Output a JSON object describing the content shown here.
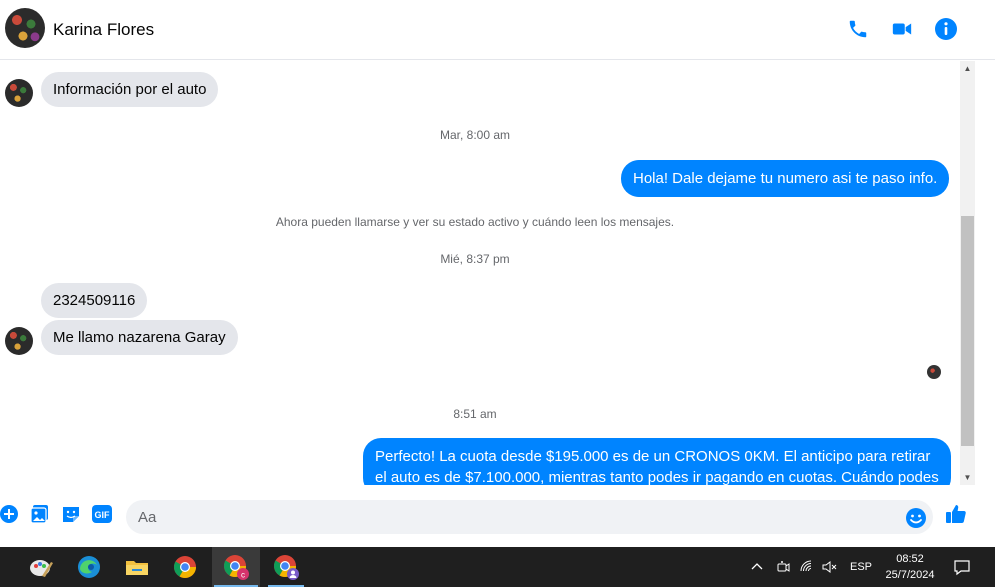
{
  "header": {
    "contact_name": "Karina Flores",
    "icons": [
      "phone-icon",
      "video-camera-icon",
      "info-icon"
    ]
  },
  "messages": {
    "incoming_1": "Información por el auto",
    "timestamp_1": "Mar, 8:00 am",
    "outgoing_1": "Hola! Dale dejame tu numero  asi te paso info.",
    "system_notice": "Ahora pueden llamarse y ver su estado activo y cuándo leen los mensajes.",
    "timestamp_2": "Mié, 8:37 pm",
    "incoming_2": "2324509116",
    "incoming_3": "Me llamo nazarena Garay",
    "timestamp_3": "8:51 am",
    "outgoing_2": "Perfecto! La cuota desde $195.000 es de un CRONOS 0KM. El anticipo para retirar el auto es de $7.100.000, mientras tanto podes ir pagando en cuotas. Cuándo podes"
  },
  "composer": {
    "placeholder": "Aa",
    "gif_label": "GIF"
  },
  "taskbar": {
    "language": "ESP",
    "time": "08:52",
    "date": "25/7/2024"
  },
  "colors": {
    "accent": "#0084ff",
    "incoming_bubble": "#e4e6eb",
    "taskbar": "#1f1f1f"
  }
}
